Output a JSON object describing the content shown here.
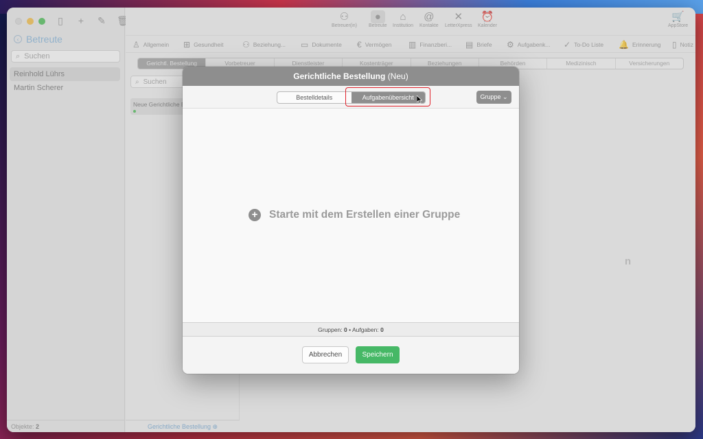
{
  "sidebar": {
    "title": "Betreute",
    "search_placeholder": "Suchen",
    "items": [
      "Reinhold Lührs",
      "Martin Scherer"
    ],
    "footer_label": "Objekte:",
    "footer_count": "2"
  },
  "toolbar": {
    "items": [
      {
        "label": "Betreuer(in)",
        "icon": "people-icon"
      },
      {
        "label": "Betreute",
        "icon": "person-icon"
      },
      {
        "label": "Institution",
        "icon": "building-icon"
      },
      {
        "label": "Kontakte",
        "icon": "contacts-icon"
      },
      {
        "label": "LetterXpress",
        "icon": "letterxpress-icon"
      },
      {
        "label": "Kalender",
        "icon": "alarm-clock-icon"
      }
    ],
    "appstore": "AppStore"
  },
  "category_tabs": [
    {
      "label": "Allgemein",
      "icon": "person-icon"
    },
    {
      "label": "Gesundheit",
      "icon": "medkit-icon"
    },
    {
      "label": "Beziehung...",
      "icon": "people-icon"
    },
    {
      "label": "Dokumente",
      "icon": "folder-icon"
    },
    {
      "label": "Vermögen",
      "icon": "euro-icon"
    },
    {
      "label": "Finanzberi...",
      "icon": "chart-icon"
    },
    {
      "label": "Briefe",
      "icon": "document-icon"
    },
    {
      "label": "Aufgabenk...",
      "icon": "tasks-icon"
    },
    {
      "label": "To-Do Liste",
      "icon": "check-circle-icon"
    },
    {
      "label": "Erinnerung",
      "icon": "bell-icon"
    },
    {
      "label": "Notiz",
      "icon": "note-icon"
    }
  ],
  "subtabs": [
    "Gerichtl. Bestellung",
    "Vorbetreuer",
    "Dienstleister",
    "Kostenträger",
    "Beziehungen",
    "Behörden",
    "Medizinisch",
    "Versicherungen"
  ],
  "list": {
    "search_placeholder": "Suchen",
    "item": "Neue Gerichtliche B",
    "footer": "Gerichtliche Bestellung"
  },
  "background_hint": "n",
  "dialog": {
    "title": "Gerichtliche Bestellung",
    "title_suffix": "(Neu)",
    "tabs": [
      "Bestelldetails",
      "Aufgabenübersicht"
    ],
    "group_button": "Gruppe",
    "empty_text": "Starte mit dem Erstellen einer Gruppe",
    "status_groups_label": "Gruppen:",
    "status_groups": "0",
    "status_sep": "•",
    "status_tasks_label": "Aufgaben:",
    "status_tasks": "0",
    "cancel": "Abbrechen",
    "save": "Speichern"
  },
  "colors": {
    "accent_blue": "#6fa3cf",
    "save_green": "#46b866",
    "highlight_red": "#e0202a"
  }
}
